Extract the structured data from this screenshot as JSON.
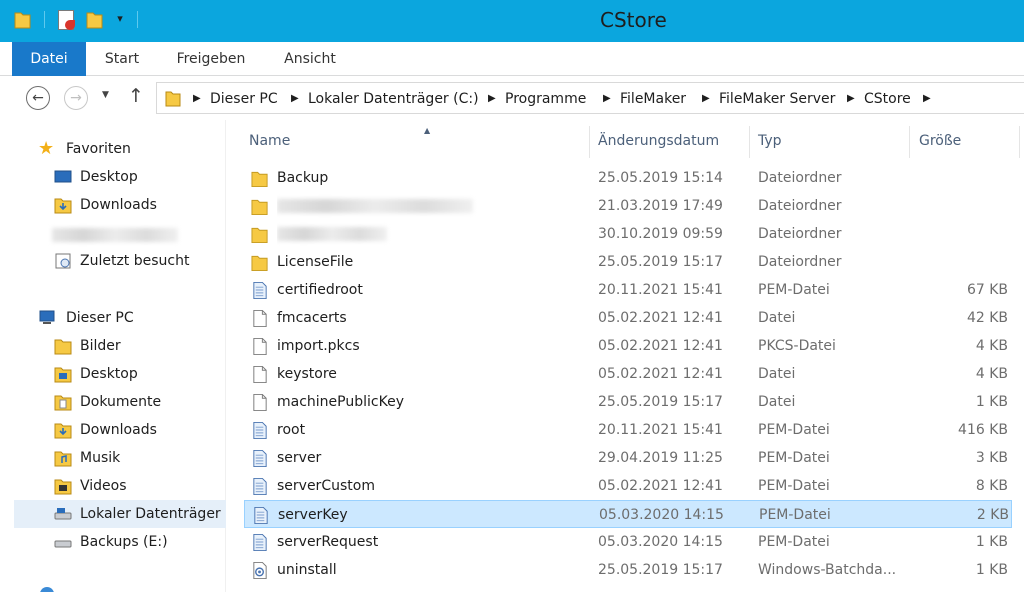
{
  "window": {
    "title": "CStore"
  },
  "ribbon": {
    "tabs": [
      "Datei",
      "Start",
      "Freigeben",
      "Ansicht"
    ]
  },
  "address": {
    "crumbs": [
      "Dieser PC",
      "Lokaler Datenträger (C:)",
      "Programme",
      "FileMaker",
      "FileMaker Server",
      "CStore"
    ]
  },
  "columns": {
    "name": "Name",
    "date": "Änderungsdatum",
    "type": "Typ",
    "size": "Größe"
  },
  "sidebar": {
    "favorites_label": "Favoriten",
    "favorites": [
      "Desktop",
      "Downloads",
      "Zuletzt besucht"
    ],
    "thispc_label": "Dieser PC",
    "thispc": [
      "Bilder",
      "Desktop",
      "Dokumente",
      "Downloads",
      "Musik",
      "Videos",
      "Lokaler Datenträger",
      "Backups (E:)"
    ]
  },
  "files": [
    {
      "name": "Backup",
      "date": "25.05.2019 15:14",
      "type": "Dateiordner",
      "size": "",
      "icon": "folder-icon"
    },
    {
      "name": "",
      "date": "21.03.2019 17:49",
      "type": "Dateiordner",
      "size": "",
      "icon": "folder-icon",
      "blurred": true
    },
    {
      "name": "",
      "date": "30.10.2019 09:59",
      "type": "Dateiordner",
      "size": "",
      "icon": "folder-icon",
      "blurred": true
    },
    {
      "name": "LicenseFile",
      "date": "25.05.2019 15:17",
      "type": "Dateiordner",
      "size": "",
      "icon": "folder-icon"
    },
    {
      "name": "certifiedroot",
      "date": "20.11.2021 15:41",
      "type": "PEM-Datei",
      "size": "67 KB",
      "icon": "pem-file-icon"
    },
    {
      "name": "fmcacerts",
      "date": "05.02.2021 12:41",
      "type": "Datei",
      "size": "42 KB",
      "icon": "file-icon"
    },
    {
      "name": "import.pkcs",
      "date": "05.02.2021 12:41",
      "type": "PKCS-Datei",
      "size": "4 KB",
      "icon": "file-icon"
    },
    {
      "name": "keystore",
      "date": "05.02.2021 12:41",
      "type": "Datei",
      "size": "4 KB",
      "icon": "file-icon"
    },
    {
      "name": "machinePublicKey",
      "date": "25.05.2019 15:17",
      "type": "Datei",
      "size": "1 KB",
      "icon": "file-icon"
    },
    {
      "name": "root",
      "date": "20.11.2021 15:41",
      "type": "PEM-Datei",
      "size": "416 KB",
      "icon": "pem-file-icon"
    },
    {
      "name": "server",
      "date": "29.04.2019 11:25",
      "type": "PEM-Datei",
      "size": "3 KB",
      "icon": "pem-file-icon"
    },
    {
      "name": "serverCustom",
      "date": "05.02.2021 12:41",
      "type": "PEM-Datei",
      "size": "8 KB",
      "icon": "pem-file-icon"
    },
    {
      "name": "serverKey",
      "date": "05.03.2020 14:15",
      "type": "PEM-Datei",
      "size": "2 KB",
      "icon": "pem-file-icon",
      "selected": true
    },
    {
      "name": "serverRequest",
      "date": "05.03.2020 14:15",
      "type": "PEM-Datei",
      "size": "1 KB",
      "icon": "pem-file-icon"
    },
    {
      "name": "uninstall",
      "date": "25.05.2019 15:17",
      "type": "Windows-Batchda...",
      "size": "1 KB",
      "icon": "batch-file-icon"
    }
  ],
  "colors": {
    "titlebar": "#0ba6de",
    "file_tab": "#1979ca",
    "selection": "#cce8ff",
    "folder": "#e8b838"
  }
}
